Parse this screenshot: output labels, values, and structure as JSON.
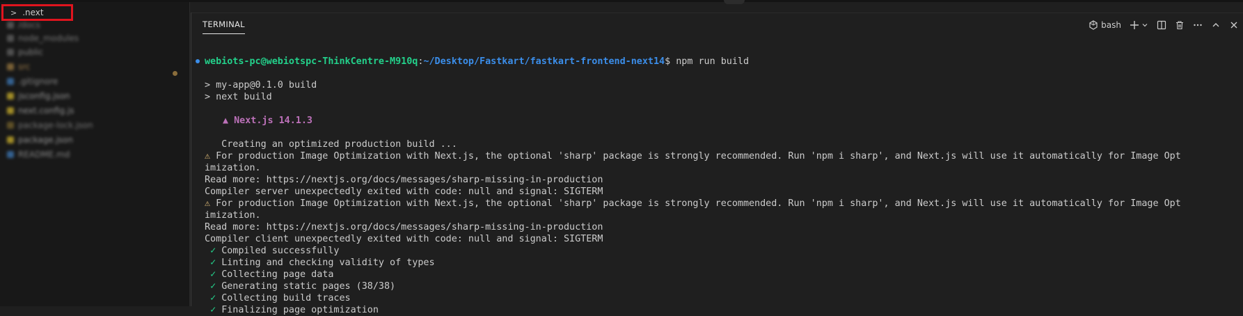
{
  "explorer": {
    "items": [
      {
        "label": ".next",
        "chevron": ">",
        "highlighted": true
      },
      {
        "label": "/docs",
        "icon_color": "#5a5a5a"
      },
      {
        "label": "node_modules",
        "icon_color": "#5a5a5a"
      },
      {
        "label": "public",
        "icon_color": "#5a5a5a"
      },
      {
        "label": "src",
        "icon_color": "#8a6d3b"
      },
      {
        "label": ".gitignore",
        "icon_color": "#3a6ea5"
      },
      {
        "label": "jsconfig.json",
        "icon_color": "#b8a02a"
      },
      {
        "label": "next.config.js",
        "icon_color": "#b8a02a"
      },
      {
        "label": "package-lock.json",
        "icon_color": "#6b5a2a"
      },
      {
        "label": "package.json",
        "icon_color": "#b8a02a"
      },
      {
        "label": "README.md",
        "icon_color": "#3a6ea5"
      }
    ]
  },
  "panel": {
    "tab_label": "TERMINAL",
    "shell_label": "bash",
    "toolbar_icons": [
      "terminal-icon",
      "plus-icon",
      "chevron-down-icon",
      "split-icon",
      "trash-icon",
      "more-icon",
      "chevron-up-icon",
      "close-icon"
    ]
  },
  "terminal": {
    "prompt_user": "webiots-pc@webiotspc-ThinkCentre-M910q",
    "prompt_sep": ":",
    "prompt_path": "~/Desktop/Fastkart/fastkart-frontend-next14",
    "prompt_cmd": "$ npm run build",
    "line_build": "> my-app@0.1.0 build",
    "line_next_build": "> next build",
    "nextjs_version": "▲ Next.js 14.1.3",
    "line_creating": "   Creating an optimized production build ...",
    "warn_icon": "⚠",
    "warn_text_1": " For production Image Optimization with Next.js, the optional 'sharp' package is strongly recommended. Run 'npm i sharp', and Next.js will use it automatically for Image Opt",
    "warn_wrap_1": "imization.",
    "read_more_1": "Read more: https://nextjs.org/docs/messages/sharp-missing-in-production",
    "compiler_server": "Compiler server unexpectedly exited with code: null and signal: SIGTERM",
    "warn_text_2": " For production Image Optimization with Next.js, the optional 'sharp' package is strongly recommended. Run 'npm i sharp', and Next.js will use it automatically for Image Opt",
    "warn_wrap_2": "imization.",
    "read_more_2": "Read more: https://nextjs.org/docs/messages/sharp-missing-in-production",
    "compiler_client": "Compiler client unexpectedly exited with code: null and signal: SIGTERM",
    "check_icon": "✓",
    "steps": [
      "Compiled successfully",
      "Linting and checking validity of types",
      "Collecting page data",
      "Generating static pages (38/38)",
      "Collecting build traces",
      "Finalizing page optimization"
    ]
  }
}
